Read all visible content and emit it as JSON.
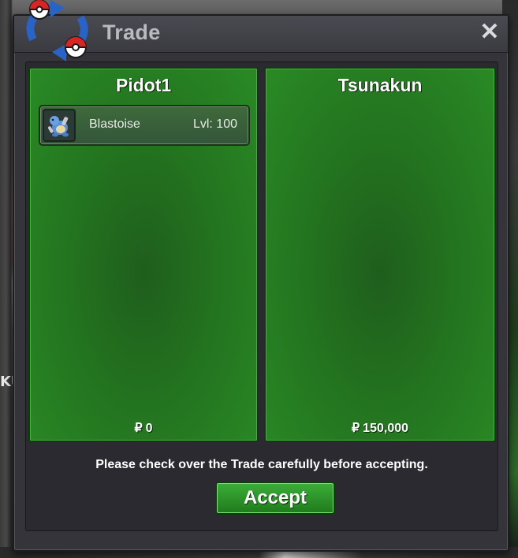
{
  "window": {
    "title": "Trade",
    "close_glyph": "✕"
  },
  "icons": {
    "logo": "trade-pokeball-arrows-icon",
    "close": "close-icon",
    "item": "blastoise-icon"
  },
  "trade": {
    "left": {
      "player": "Pidot1",
      "items": [
        {
          "name": "Blastoise",
          "level": "Lvl: 100"
        }
      ],
      "currency_symbol": "₽",
      "money": "0"
    },
    "right": {
      "player": "Tsunakun",
      "items": [],
      "currency_symbol": "₽",
      "money": "150,000"
    }
  },
  "notice": "Please check over the Trade carefully before accepting.",
  "accept_label": "Accept",
  "background": {
    "edge_text": "KU"
  },
  "colors": {
    "panel_green": "#23731f",
    "accept_green": "#2d9629",
    "window": "#34343a"
  }
}
